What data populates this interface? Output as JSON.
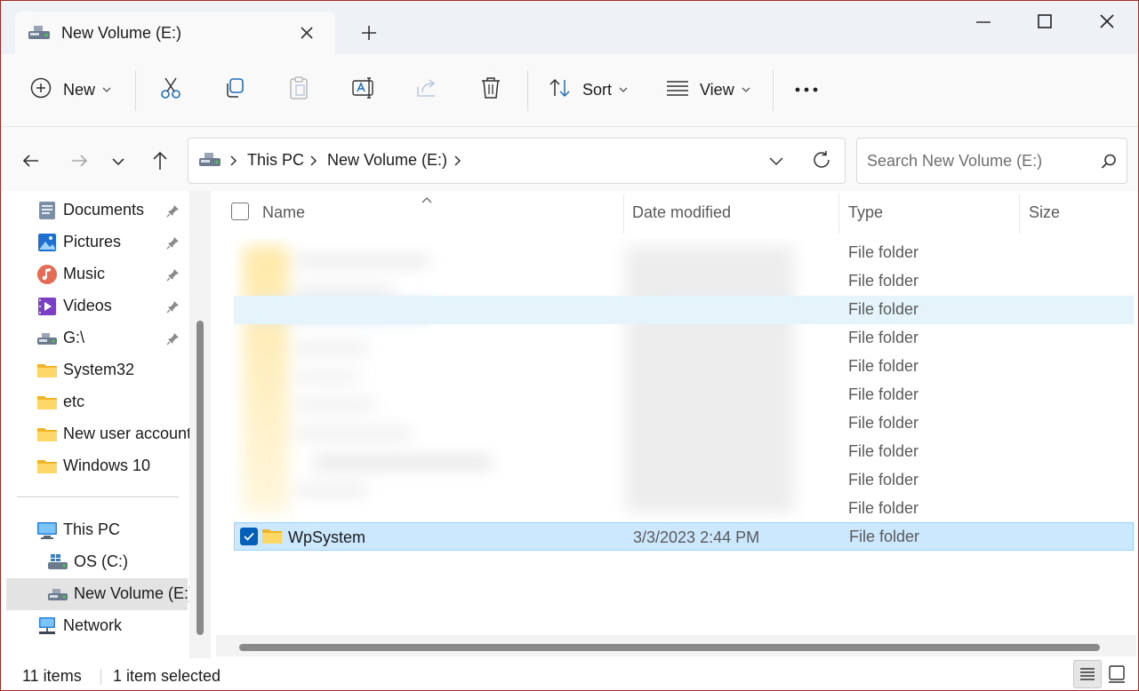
{
  "window": {
    "tab_title": "New Volume (E:)",
    "accent": "#005fb8"
  },
  "toolbar": {
    "new_label": "New",
    "sort_label": "Sort",
    "view_label": "View"
  },
  "address": {
    "crumbs": [
      "This PC",
      "New Volume (E:)"
    ]
  },
  "search": {
    "placeholder": "Search New Volume (E:)"
  },
  "sidebar": {
    "quick_access": [
      {
        "label": "Documents",
        "icon": "documents-icon",
        "pinned": true
      },
      {
        "label": "Pictures",
        "icon": "pictures-icon",
        "pinned": true
      },
      {
        "label": "Music",
        "icon": "music-icon",
        "pinned": true
      },
      {
        "label": "Videos",
        "icon": "videos-icon",
        "pinned": true
      },
      {
        "label": "G:\\",
        "icon": "drive-icon",
        "pinned": true
      },
      {
        "label": "System32",
        "icon": "folder-icon",
        "pinned": false
      },
      {
        "label": "etc",
        "icon": "folder-icon",
        "pinned": false
      },
      {
        "label": "New user account",
        "icon": "folder-icon",
        "pinned": false
      },
      {
        "label": "Windows 10",
        "icon": "folder-icon",
        "pinned": false
      }
    ],
    "this_pc": "This PC",
    "drives": [
      "OS (C:)",
      "New Volume (E:)"
    ],
    "network": "Network"
  },
  "columns": {
    "name": "Name",
    "date": "Date modified",
    "type": "Type",
    "size": "Size"
  },
  "rows": [
    {
      "type": "File folder"
    },
    {
      "type": "File folder"
    },
    {
      "type": "File folder"
    },
    {
      "type": "File folder"
    },
    {
      "type": "File folder"
    },
    {
      "type": "File folder"
    },
    {
      "type": "File folder"
    },
    {
      "type": "File folder"
    },
    {
      "type": "File folder"
    },
    {
      "type": "File folder"
    }
  ],
  "selected_row": {
    "name": "WpSystem",
    "date": "3/3/2023 2:44 PM",
    "type": "File folder"
  },
  "status": {
    "item_count": "11 items",
    "selection": "1 item selected"
  }
}
